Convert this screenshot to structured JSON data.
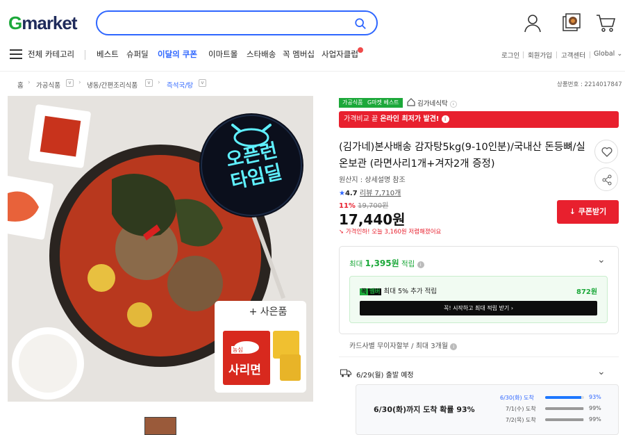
{
  "header": {
    "logo_g": "G",
    "logo_rest": "market",
    "search_placeholder": "",
    "icons": [
      "search-icon",
      "user-icon",
      "recent-view-icon",
      "cart-icon"
    ]
  },
  "nav": {
    "all_categories": "전체 카테고리",
    "items": [
      "베스트",
      "슈퍼딜",
      "이달의 쿠폰",
      "이마트몰",
      "스타배송",
      "꼭 멤버십",
      "사업자클럽"
    ],
    "highlight_color": "#2e66ff",
    "util": [
      "로그인",
      "회원가입",
      "고객센터",
      "Global"
    ]
  },
  "breadcrumb": {
    "items": [
      "홈",
      "가공식품",
      "냉동/간편조리식품",
      "즉석국/탕"
    ],
    "product_no": "상품번호 : 2214017847"
  },
  "image": {
    "headline1": "오픈런",
    "headline2": "타임딜",
    "gift_label": "+ 사은품",
    "gift_brand": "농심",
    "gift_name": "사리면"
  },
  "product": {
    "badge_cat": "가공식품",
    "badge_best": "G마켓 베스트",
    "seller": "김가네식탁",
    "promo_prefix": "가격비교 끝 ",
    "promo_bold": "온라인 최저가 발견!",
    "title": "(김가네)본사배송 감자탕5kg(9-10인분)/국내산 돈등뼈/실온보관 (라면사리1개+겨자2개 증정)",
    "origin": "원산지 : 상세설명 참조",
    "rating": "4.7",
    "reviews": "리뷰 7,710개",
    "discount": "11%",
    "orig_price": "19,700원",
    "price": "17,440원",
    "price_note": "가격인하! 오늘 3,160원 저렴해졌어요",
    "coupon_btn": "쿠폰받기",
    "accent": "#e8202e"
  },
  "points": {
    "max_label": "최대 ",
    "max_value": "1,395원",
    "max_suffix": " 적립",
    "member_tag1": "꼭",
    "member_tag2": "멤버",
    "member_text": "최대 5% 추가 적립",
    "member_value": "872원",
    "cta": "꼭! 시작하고 최대 적립 받기 ›"
  },
  "card": "카드사별 무이자할부 / 최대 3개월",
  "delivery": {
    "depart": "6/29(월) 출발 예정",
    "arrival": "6/30(화)까지 도착 확률 93%",
    "rows": [
      {
        "label": "6/30(화) 도착",
        "pct": "93%",
        "value": 0.93
      },
      {
        "label": "7/1(수) 도착",
        "pct": "99%",
        "value": 0.99
      },
      {
        "label": "7/2(목) 도착",
        "pct": "99%",
        "value": 0.99
      }
    ]
  }
}
